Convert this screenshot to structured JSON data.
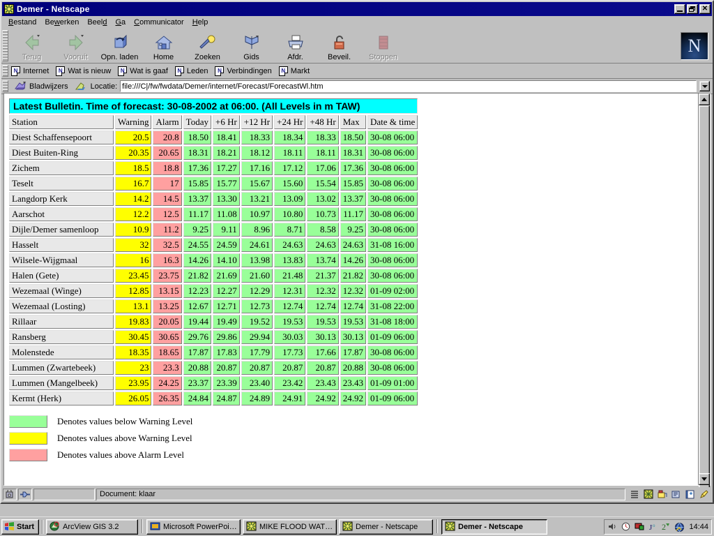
{
  "window": {
    "title": "Demer - Netscape",
    "icon": "netscape-document-icon",
    "buttons": {
      "minimize": "_",
      "restore": "restore",
      "close": "close"
    }
  },
  "menubar": [
    {
      "label": "Bestand",
      "accel": "B"
    },
    {
      "label": "Bewerken",
      "accel": "w"
    },
    {
      "label": "Beeld",
      "accel": "d"
    },
    {
      "label": "Ga",
      "accel": "G"
    },
    {
      "label": "Communicator",
      "accel": "C"
    },
    {
      "label": "Help",
      "accel": "H"
    }
  ],
  "navbar": {
    "buttons": [
      {
        "label": "Terug",
        "icon": "back-arrow-icon",
        "disabled": true
      },
      {
        "label": "Vooruit",
        "icon": "forward-arrow-icon",
        "disabled": true
      },
      {
        "label": "Opn. laden",
        "icon": "reload-icon",
        "disabled": false
      },
      {
        "label": "Home",
        "icon": "home-icon",
        "disabled": false
      },
      {
        "label": "Zoeken",
        "icon": "search-icon",
        "disabled": false
      },
      {
        "label": "Gids",
        "icon": "guide-icon",
        "disabled": false
      },
      {
        "label": "Afdr.",
        "icon": "printer-icon",
        "disabled": false
      },
      {
        "label": "Beveil.",
        "icon": "lock-icon",
        "disabled": false
      },
      {
        "label": "Stoppen",
        "icon": "stop-icon",
        "disabled": true
      }
    ],
    "logo": "N"
  },
  "personalbar": [
    {
      "label": "Internet",
      "icon": "netscape-page-icon"
    },
    {
      "label": "Wat is nieuw",
      "icon": "netscape-page-icon"
    },
    {
      "label": "Wat is gaaf",
      "icon": "netscape-page-icon"
    },
    {
      "label": "Leden",
      "icon": "netscape-page-icon"
    },
    {
      "label": "Verbindingen",
      "icon": "netscape-page-icon"
    },
    {
      "label": "Markt",
      "icon": "netscape-page-icon"
    }
  ],
  "locationbar": {
    "bookmarks_label": "Bladwijzers",
    "bookmarks_icon": "bookmark-icon",
    "page_icon": "page-proxy-icon",
    "location_label": "Locatie:",
    "url": "file:///C|/fw/fwdata/Demer/internet/Forecast/ForecastWl.htm"
  },
  "page": {
    "bulletin": "Latest Bulletin. Time of forecast: 30-08-2002 at 06:00. (All Levels in m TAW)",
    "columns": [
      "Station",
      "Warning",
      "Alarm",
      "Today",
      "+6 Hr",
      "+12 Hr",
      "+24 Hr",
      "+48 Hr",
      "Max",
      "Date & time"
    ],
    "rows": [
      {
        "station": "Diest Schaffensepoort",
        "warning": "20.5",
        "alarm": "20.8",
        "today": "18.50",
        "h6": "18.41",
        "h12": "18.33",
        "h24": "18.34",
        "h48": "18.33",
        "max": "18.50",
        "datetime": "30-08 06:00"
      },
      {
        "station": "Diest Buiten-Ring",
        "warning": "20.35",
        "alarm": "20.65",
        "today": "18.31",
        "h6": "18.21",
        "h12": "18.12",
        "h24": "18.11",
        "h48": "18.11",
        "max": "18.31",
        "datetime": "30-08 06:00"
      },
      {
        "station": "Zichem",
        "warning": "18.5",
        "alarm": "18.8",
        "today": "17.36",
        "h6": "17.27",
        "h12": "17.16",
        "h24": "17.12",
        "h48": "17.06",
        "max": "17.36",
        "datetime": "30-08 06:00"
      },
      {
        "station": "Teselt",
        "warning": "16.7",
        "alarm": "17",
        "today": "15.85",
        "h6": "15.77",
        "h12": "15.67",
        "h24": "15.60",
        "h48": "15.54",
        "max": "15.85",
        "datetime": "30-08 06:00"
      },
      {
        "station": "Langdorp Kerk",
        "warning": "14.2",
        "alarm": "14.5",
        "today": "13.37",
        "h6": "13.30",
        "h12": "13.21",
        "h24": "13.09",
        "h48": "13.02",
        "max": "13.37",
        "datetime": "30-08 06:00"
      },
      {
        "station": "Aarschot",
        "warning": "12.2",
        "alarm": "12.5",
        "today": "11.17",
        "h6": "11.08",
        "h12": "10.97",
        "h24": "10.80",
        "h48": "10.73",
        "max": "11.17",
        "datetime": "30-08 06:00"
      },
      {
        "station": "Dijle/Demer samenloop",
        "warning": "10.9",
        "alarm": "11.2",
        "today": "9.25",
        "h6": "9.11",
        "h12": "8.96",
        "h24": "8.71",
        "h48": "8.58",
        "max": "9.25",
        "datetime": "30-08 06:00"
      },
      {
        "station": "Hasselt",
        "warning": "32",
        "alarm": "32.5",
        "today": "24.55",
        "h6": "24.59",
        "h12": "24.61",
        "h24": "24.63",
        "h48": "24.63",
        "max": "24.63",
        "datetime": "31-08 16:00"
      },
      {
        "station": "Wilsele-Wijgmaal",
        "warning": "16",
        "alarm": "16.3",
        "today": "14.26",
        "h6": "14.10",
        "h12": "13.98",
        "h24": "13.83",
        "h48": "13.74",
        "max": "14.26",
        "datetime": "30-08 06:00"
      },
      {
        "station": "Halen (Gete)",
        "warning": "23.45",
        "alarm": "23.75",
        "today": "21.82",
        "h6": "21.69",
        "h12": "21.60",
        "h24": "21.48",
        "h48": "21.37",
        "max": "21.82",
        "datetime": "30-08 06:00"
      },
      {
        "station": "Wezemaal (Winge)",
        "warning": "12.85",
        "alarm": "13.15",
        "today": "12.23",
        "h6": "12.27",
        "h12": "12.29",
        "h24": "12.31",
        "h48": "12.32",
        "max": "12.32",
        "datetime": "01-09 02:00"
      },
      {
        "station": "Wezemaal (Losting)",
        "warning": "13.1",
        "alarm": "13.25",
        "today": "12.67",
        "h6": "12.71",
        "h12": "12.73",
        "h24": "12.74",
        "h48": "12.74",
        "max": "12.74",
        "datetime": "31-08 22:00"
      },
      {
        "station": "Rillaar",
        "warning": "19.83",
        "alarm": "20.05",
        "today": "19.44",
        "h6": "19.49",
        "h12": "19.52",
        "h24": "19.53",
        "h48": "19.53",
        "max": "19.53",
        "datetime": "31-08 18:00"
      },
      {
        "station": "Ransberg",
        "warning": "30.45",
        "alarm": "30.65",
        "today": "29.76",
        "h6": "29.86",
        "h12": "29.94",
        "h24": "30.03",
        "h48": "30.13",
        "max": "30.13",
        "datetime": "01-09 06:00"
      },
      {
        "station": "Molenstede",
        "warning": "18.35",
        "alarm": "18.65",
        "today": "17.87",
        "h6": "17.83",
        "h12": "17.79",
        "h24": "17.73",
        "h48": "17.66",
        "max": "17.87",
        "datetime": "30-08 06:00"
      },
      {
        "station": "Lummen (Zwartebeek)",
        "warning": "23",
        "alarm": "23.3",
        "today": "20.88",
        "h6": "20.87",
        "h12": "20.87",
        "h24": "20.87",
        "h48": "20.87",
        "max": "20.88",
        "datetime": "30-08 06:00"
      },
      {
        "station": "Lummen (Mangelbeek)",
        "warning": "23.95",
        "alarm": "24.25",
        "today": "23.37",
        "h6": "23.39",
        "h12": "23.40",
        "h24": "23.42",
        "h48": "23.43",
        "max": "23.43",
        "datetime": "01-09 01:00"
      },
      {
        "station": "Kermt (Herk)",
        "warning": "26.05",
        "alarm": "26.35",
        "today": "24.84",
        "h6": "24.87",
        "h12": "24.89",
        "h24": "24.91",
        "h48": "24.92",
        "max": "24.92",
        "datetime": "01-09 06:00"
      }
    ],
    "legend": [
      {
        "color": "#99ff99",
        "text": "Denotes values below Warning Level"
      },
      {
        "color": "#ffff00",
        "text": "Denotes values above Warning Level"
      },
      {
        "color": "#ffa0a0",
        "text": "Denotes values above Alarm Level"
      }
    ]
  },
  "statusbar": {
    "message": "Document: klaar",
    "icons": [
      "security-lock-icon",
      "network-connection-icon"
    ],
    "tray_icons": [
      "list-icon",
      "netscape-icon",
      "mailbox-icon",
      "newsgroup-icon",
      "addressbook-icon",
      "composer-icon"
    ]
  },
  "taskbar": {
    "start_label": "Start",
    "items": [
      {
        "label": "ArcView GIS 3.2",
        "icon": "arcview-icon",
        "active": false
      },
      {
        "label": "Microsoft PowerPoint - [lou...",
        "icon": "powerpoint-icon",
        "active": false
      },
      {
        "label": "MIKE FLOOD WATCH - D...",
        "icon": "netscape-icon",
        "active": false
      },
      {
        "label": "Demer - Netscape",
        "icon": "netscape-icon",
        "active": false
      },
      {
        "label": "Demer - Netscape",
        "icon": "netscape-icon",
        "active": true
      }
    ],
    "clock": "14:44",
    "tray": [
      "volume-icon",
      "clock-tool-icon",
      "display-icon",
      "keyboard-layout-icon",
      "antivirus-icon",
      "network-icon"
    ]
  },
  "colors": {
    "titlebar": "#00007b",
    "bulletin_bg": "#00ffff",
    "warning": "#ffff00",
    "alarm": "#ffa0a0",
    "ok": "#99ff99",
    "face": "#c0c0c0"
  }
}
